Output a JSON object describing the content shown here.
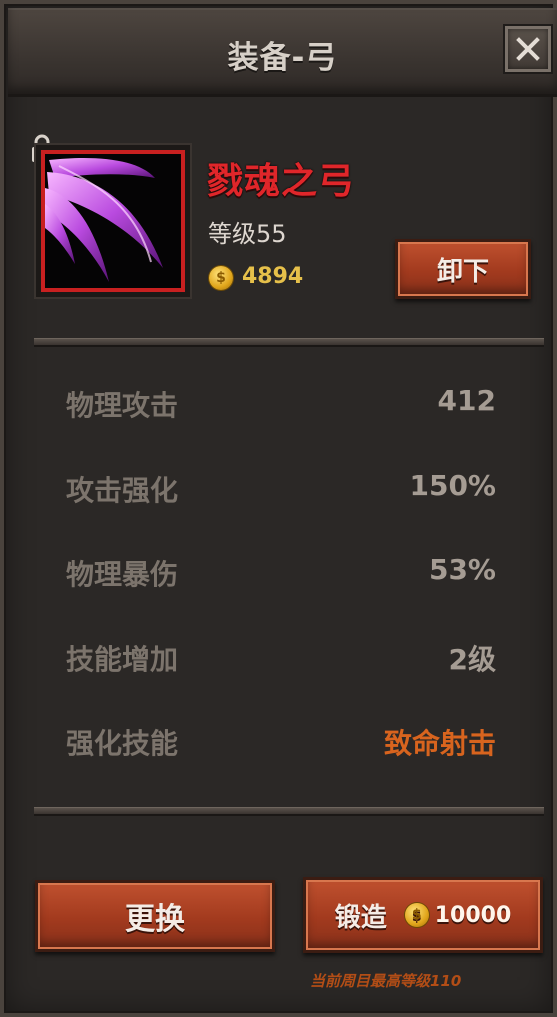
{
  "header": {
    "title": "装备-弓",
    "close_icon": "close-icon"
  },
  "item": {
    "name": "戮魂之弓",
    "level_text": "等级55",
    "price": "4894",
    "locked": true,
    "icon": "purple-claw-icon",
    "name_color": "#e0262a",
    "frame_color": "#c82020"
  },
  "buttons": {
    "unequip_label": "卸下",
    "change_label": "更换",
    "forge_label": "锻造",
    "forge_cost": "10000"
  },
  "stats": [
    {
      "label": "物理攻击",
      "value": "412"
    },
    {
      "label": "攻击强化",
      "value": "150%"
    },
    {
      "label": "物理暴伤",
      "value": "53%"
    },
    {
      "label": "技能增加",
      "value": "2级"
    },
    {
      "label": "强化技能",
      "value": "致命射击"
    }
  ],
  "footer": {
    "note": "当前周目最高等级110"
  },
  "colors": {
    "accent_red": "#a23a1e",
    "skill_orange": "#d8641e",
    "coin_gold": "#e6c04a"
  }
}
